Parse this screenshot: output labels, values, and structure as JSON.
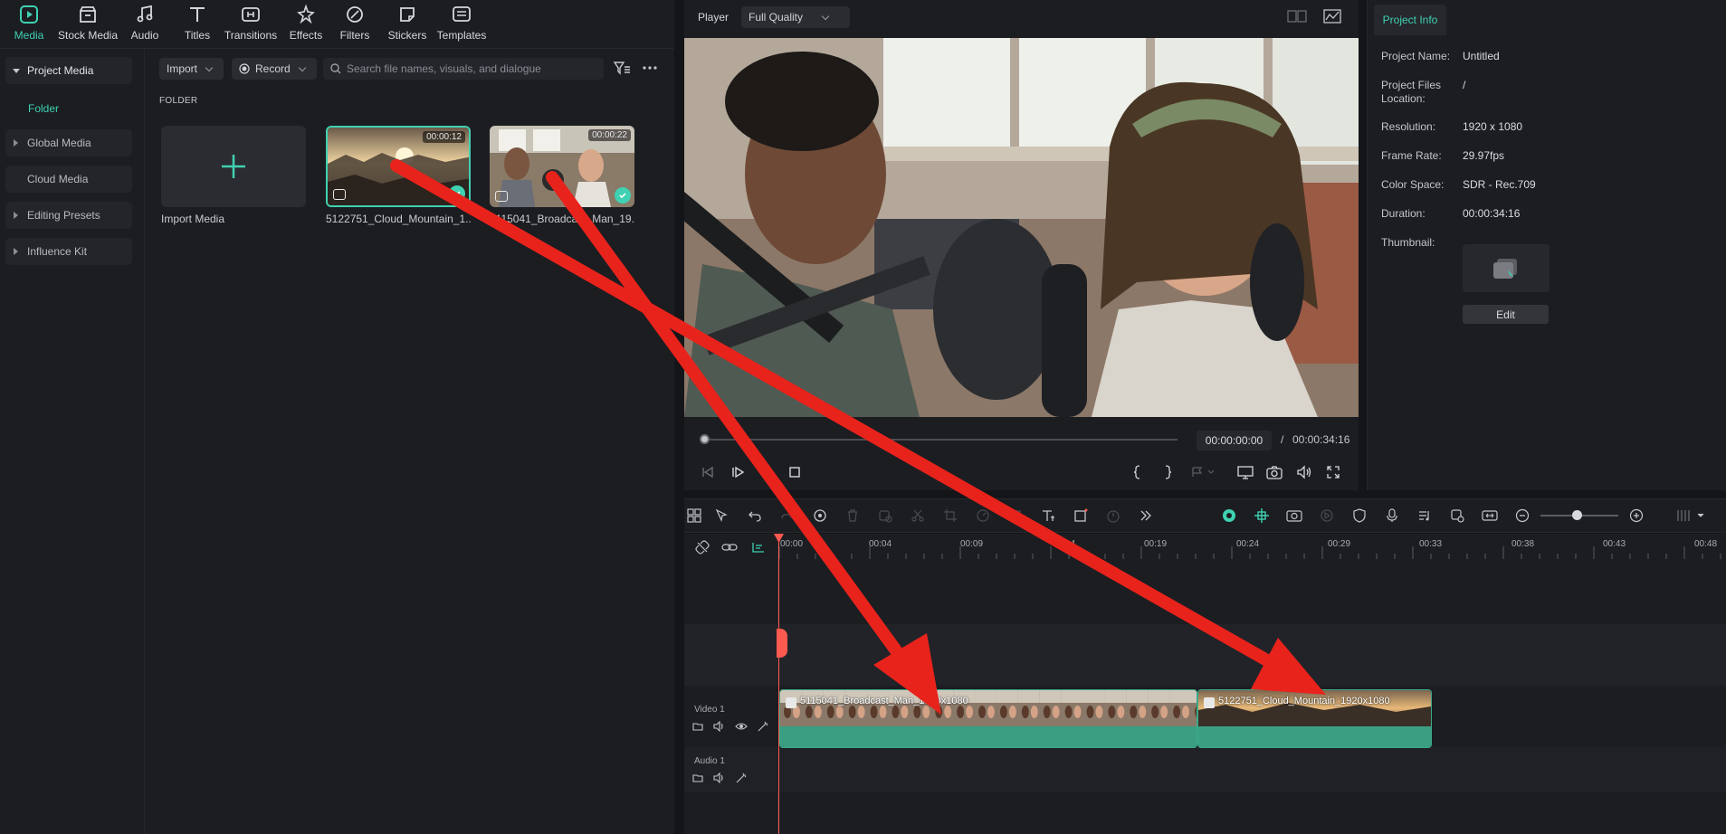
{
  "nav": {
    "items": [
      {
        "label": "Media",
        "icon": "media-icon"
      },
      {
        "label": "Stock Media",
        "icon": "stock-media-icon"
      },
      {
        "label": "Audio",
        "icon": "music-note-icon"
      },
      {
        "label": "Titles",
        "icon": "text-t-icon"
      },
      {
        "label": "Transitions",
        "icon": "transitions-icon"
      },
      {
        "label": "Effects",
        "icon": "effects-icon"
      },
      {
        "label": "Filters",
        "icon": "filters-icon"
      },
      {
        "label": "Stickers",
        "icon": "stickers-icon"
      },
      {
        "label": "Templates",
        "icon": "templates-icon"
      }
    ],
    "active": "Media"
  },
  "sidebar": {
    "items": [
      {
        "label": "Project Media"
      },
      {
        "label": "Global Media"
      },
      {
        "label": "Cloud Media"
      },
      {
        "label": "Editing Presets"
      },
      {
        "label": "Influence Kit"
      }
    ],
    "folder": "Folder"
  },
  "media_toolbar": {
    "import": "Import",
    "record": "Record",
    "search_placeholder": "Search file names, visuals, and dialogue"
  },
  "folder_heading": "FOLDER",
  "media_items": [
    {
      "label": "Import Media"
    },
    {
      "label": "5122751_Cloud_Mountain_1...",
      "duration": "00:00:12"
    },
    {
      "label": "5115041_Broadcast_Man_19...",
      "duration": "00:00:22"
    }
  ],
  "player": {
    "label": "Player",
    "quality": "Full Quality",
    "current_time": "00:00:00:00",
    "separator": "/",
    "total_time": "00:00:34:16",
    "progress": 0
  },
  "project_info": {
    "tab": "Project Info",
    "rows": [
      {
        "label": "Project Name:",
        "value": "Untitled"
      },
      {
        "label": "Project Files Location:",
        "value": "/"
      },
      {
        "label": "Resolution:",
        "value": "1920 x 1080"
      },
      {
        "label": "Frame Rate:",
        "value": "29.97fps"
      },
      {
        "label": "Color Space:",
        "value": "SDR - Rec.709"
      },
      {
        "label": "Duration:",
        "value": "00:00:34:16"
      },
      {
        "label": "Thumbnail:",
        "value": ""
      }
    ],
    "edit": "Edit"
  },
  "timeline": {
    "ruler": [
      "00:00",
      "00:04",
      "00:09",
      "00:14",
      "00:19",
      "00:24",
      "00:29",
      "00:33",
      "00:38",
      "00:43",
      "00:48"
    ],
    "tracks": [
      {
        "label": "Video 1"
      },
      {
        "label": "Audio 1"
      }
    ],
    "clips": [
      {
        "title": "5115041_Broadcast_Man_1920x1080"
      },
      {
        "title": "5122751_Cloud_Mountain_1920x1080"
      }
    ]
  },
  "colors": {
    "accent": "#3fd1b2",
    "annotation_arrow": "#e8231c",
    "playhead": "#ff5a4f",
    "clip_bar": "#3b9e82"
  }
}
